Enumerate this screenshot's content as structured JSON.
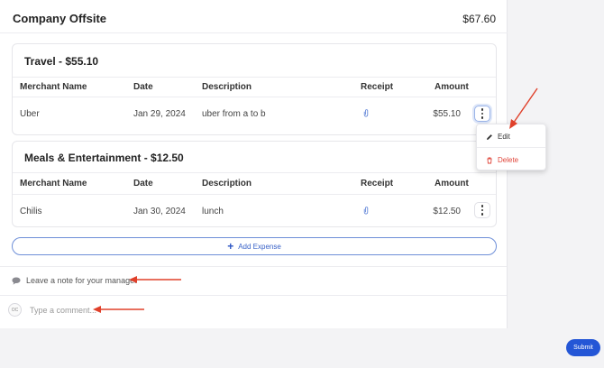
{
  "report": {
    "title": "Company Offsite",
    "total": "$67.60"
  },
  "columns": {
    "merchant": "Merchant Name",
    "date": "Date",
    "description": "Description",
    "receipt": "Receipt",
    "amount": "Amount"
  },
  "categories": [
    {
      "title": "Travel - $55.10",
      "rows": [
        {
          "merchant": "Uber",
          "date": "Jan 29, 2024",
          "description": "uber from a to b",
          "amount": "$55.10"
        }
      ]
    },
    {
      "title": "Meals & Entertainment - $12.50",
      "rows": [
        {
          "merchant": "Chilis",
          "date": "Jan 30, 2024",
          "description": "lunch",
          "amount": "$12.50"
        }
      ]
    }
  ],
  "add_expense": "Add Expense",
  "note": {
    "label": "Leave a note for your manager"
  },
  "comment": {
    "avatar": "OC",
    "placeholder": "Type a comment..."
  },
  "menu": {
    "edit": "Edit",
    "delete": "Delete"
  },
  "submit": "Submit",
  "colors": {
    "accent": "#2456d6",
    "danger": "#e0453a",
    "annotation": "#e0402a"
  },
  "icons": {
    "receipt": "paperclip-icon",
    "note": "speech-bubble-icon",
    "edit": "pencil-icon",
    "delete": "trash-icon",
    "more": "kebab-icon"
  }
}
